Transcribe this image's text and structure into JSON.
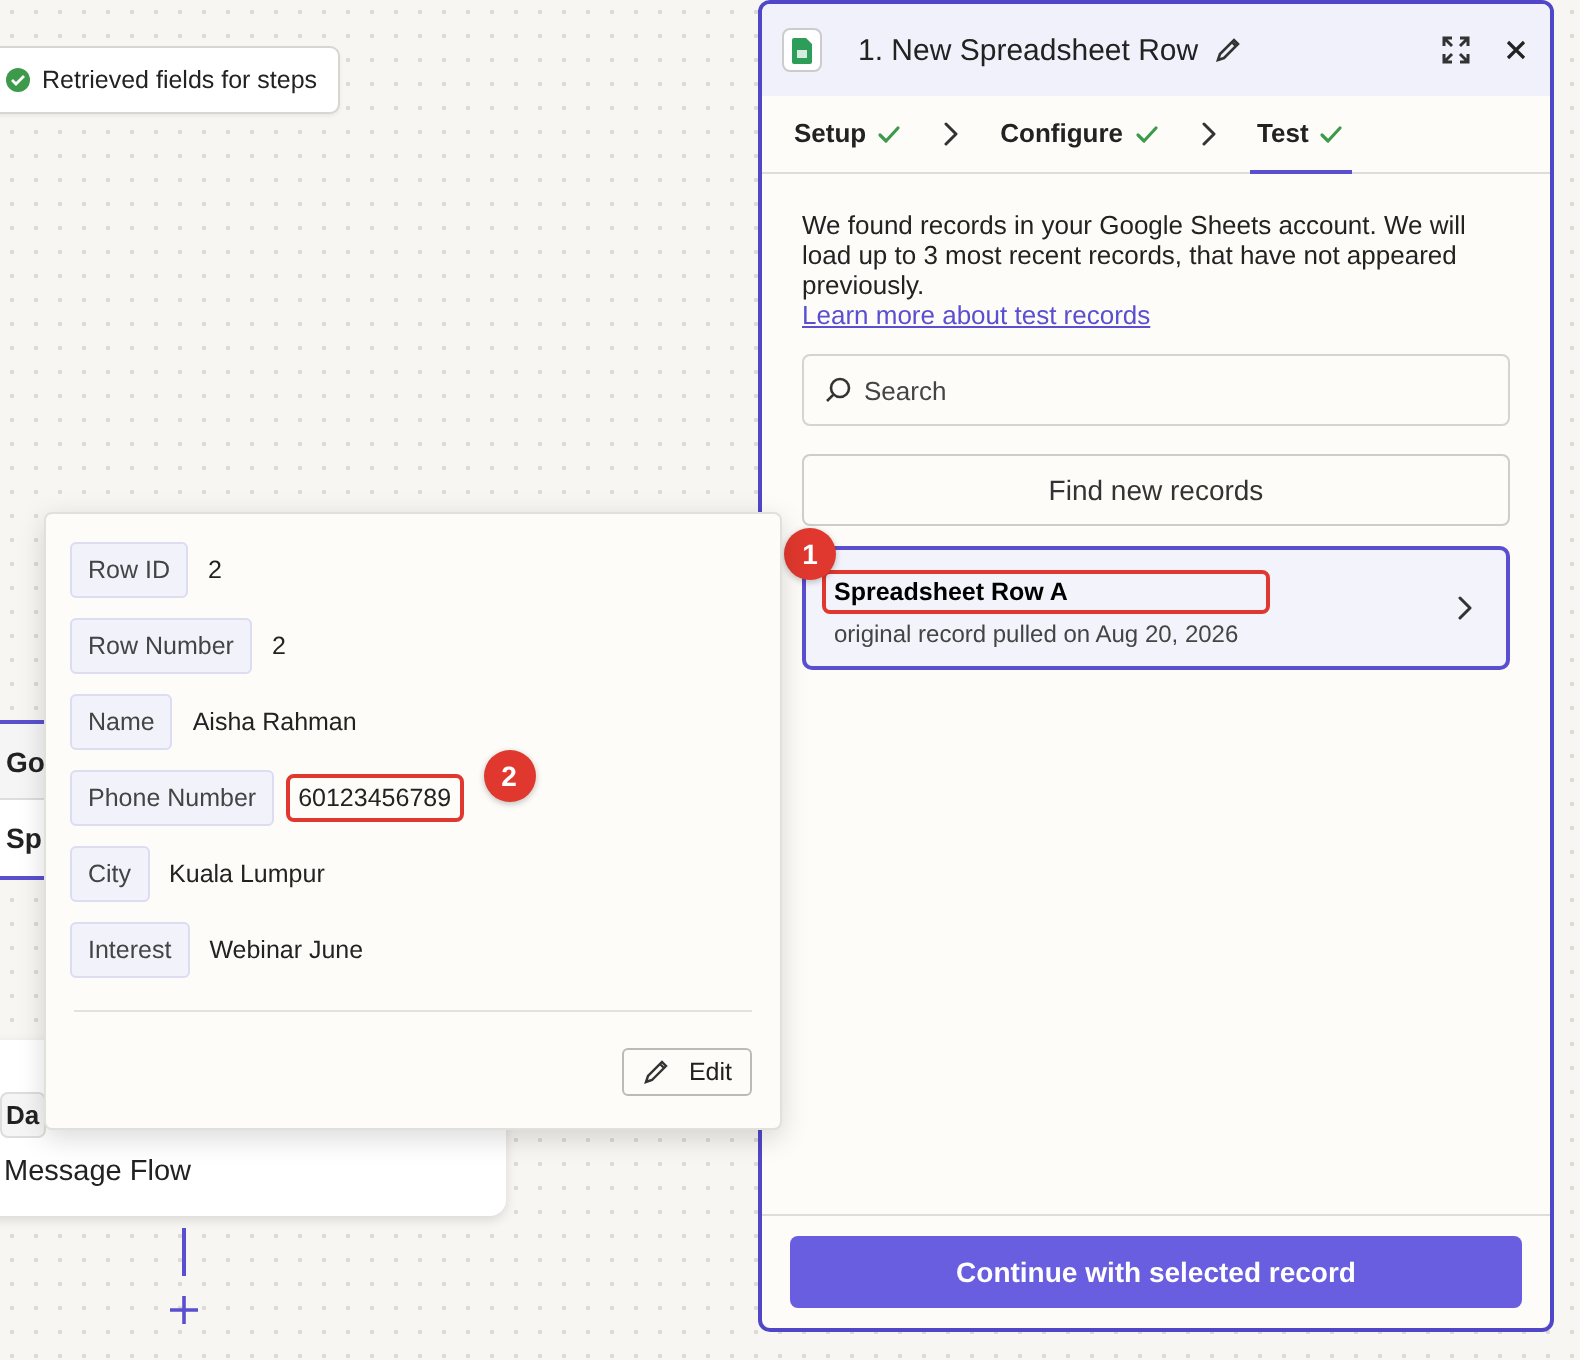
{
  "canvas": {
    "status_chip": {
      "text": "Retrieved fields for steps"
    },
    "nodes": [
      {
        "kind": "trigger",
        "lines": [
          "Go",
          "Sp"
        ]
      },
      {
        "kind": "action",
        "tag": "Da",
        "title": "Message Flow"
      }
    ]
  },
  "panel": {
    "title": "1. New Spreadsheet Row",
    "tabs": [
      {
        "label": "Setup",
        "done": true,
        "selected": false
      },
      {
        "label": "Configure",
        "done": true,
        "selected": false
      },
      {
        "label": "Test",
        "done": true,
        "selected": true
      }
    ],
    "description": "We found records in your Google Sheets account. We will load up to 3 most recent records, that have not appeared previously.",
    "link": "Learn more about test records",
    "search": {
      "placeholder": "Search"
    },
    "find_button": "Find new records",
    "records": [
      {
        "title": "Spreadsheet Row A",
        "subtitle": "original record pulled on Aug 20, 2026",
        "selected": true,
        "annotation": "1"
      }
    ],
    "continue_button": "Continue with selected record"
  },
  "popover": {
    "fields": [
      {
        "label": "Row ID",
        "value": "2"
      },
      {
        "label": "Row Number",
        "value": "2"
      },
      {
        "label": "Name",
        "value": "Aisha Rahman"
      },
      {
        "label": "Phone Number",
        "value": "60123456789",
        "annotation": "2"
      },
      {
        "label": "City",
        "value": "Kuala Lumpur"
      },
      {
        "label": "Interest",
        "value": "Webinar June"
      }
    ],
    "edit_button": "Edit"
  }
}
